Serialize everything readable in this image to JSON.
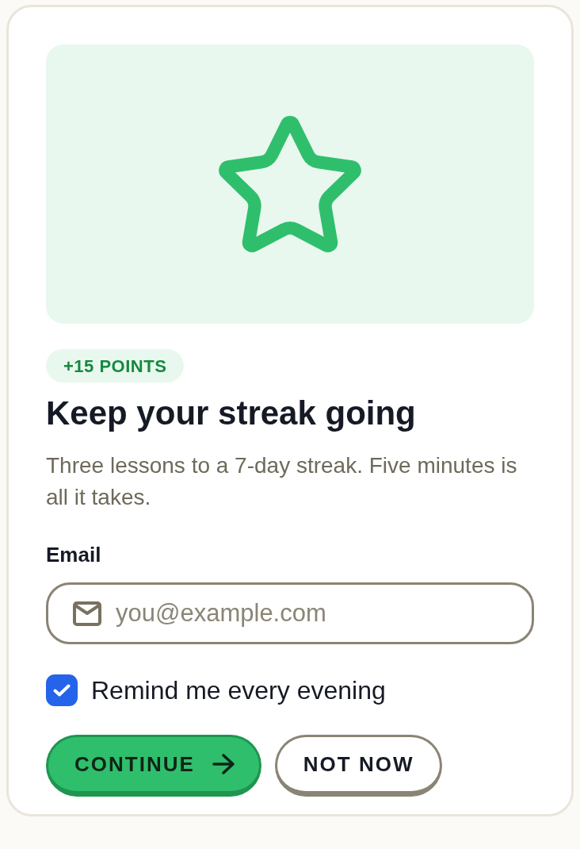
{
  "badge": "+15 POINTS",
  "title": "Keep your streak going",
  "description": "Three lessons to a 7-day streak. Five minutes is all it takes.",
  "email": {
    "label": "Email",
    "placeholder": "you@example.com"
  },
  "reminder": {
    "label": "Remind me every evening",
    "checked": true
  },
  "buttons": [
    {
      "label": "CONTINUE",
      "kind": "primary"
    },
    {
      "label": "NOT NOW",
      "kind": "secondary"
    }
  ]
}
